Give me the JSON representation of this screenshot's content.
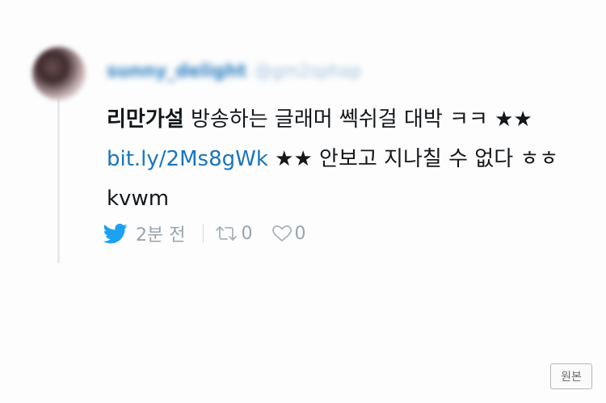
{
  "user": {
    "display_name": "sunny_delight",
    "handle": "@gm2sphap"
  },
  "tweet": {
    "bold_text": "리만가설",
    "text_part1": " 방송하는 글래머 쎅쉬걸 대박 ㅋㅋ ★★ ",
    "link": "bit.ly/2Ms8gWk",
    "text_part2": " ★★ 안보고 지나칠 수 없다 ㅎㅎ kvwm"
  },
  "meta": {
    "time": "2분 전",
    "retweet_count": "0",
    "like_count": "0"
  },
  "original_button": {
    "label": "원본"
  },
  "colors": {
    "twitter_blue": "#1da1f2",
    "link_blue": "#1b75bb",
    "muted_gray": "#9aa3ab"
  }
}
